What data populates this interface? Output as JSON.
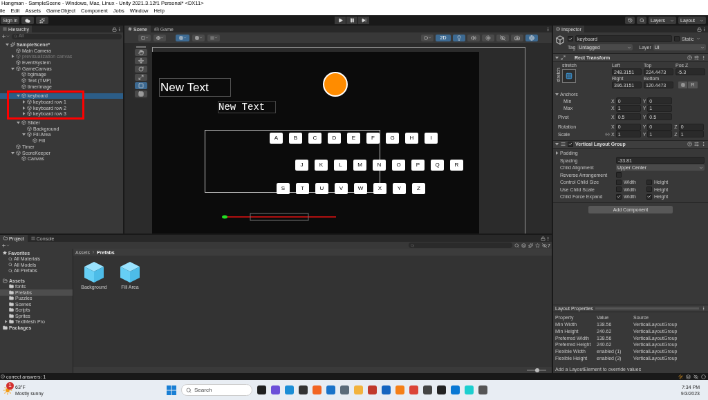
{
  "title_bar": {
    "title": "Hangman - SampleScene - Windows, Mac, Linux - Unity 2021.3.12f1 Personal* <DX11>"
  },
  "menu": [
    "ile",
    "Edit",
    "Assets",
    "GameObject",
    "Component",
    "Jobs",
    "Window",
    "Help"
  ],
  "toolbar": {
    "sign_in": "Sign in",
    "layers": "Layers",
    "layout": "Layout"
  },
  "hierarchy": {
    "tab": "Hierarchy",
    "search_placeholder": "All",
    "tree": [
      {
        "name": "SampleScene*",
        "kind": "scene",
        "expanded": true,
        "selected": false,
        "disabled": false,
        "children": [
          {
            "name": "Main Camera",
            "kind": "object",
            "selected": false,
            "disabled": false
          },
          {
            "name": "previsualization canvas",
            "kind": "object",
            "expanded": false,
            "selected": false,
            "disabled": true
          },
          {
            "name": "EventSystem",
            "kind": "object",
            "selected": false,
            "disabled": false
          },
          {
            "name": "GameCanvas",
            "kind": "object",
            "expanded": true,
            "selected": false,
            "disabled": false,
            "children": [
              {
                "name": "bgimage",
                "kind": "object",
                "selected": false,
                "disabled": false
              },
              {
                "name": "Text (TMP)",
                "kind": "object",
                "selected": false,
                "disabled": false
              },
              {
                "name": "timerImage",
                "kind": "object",
                "selected": false,
                "disabled": false
              },
              {
                "name": "keyboard",
                "kind": "object",
                "expanded": true,
                "selected": true,
                "disabled": false,
                "circled": true,
                "children": [
                  {
                    "name": "keyboard row 1",
                    "kind": "object",
                    "expanded": false,
                    "selected": false,
                    "disabled": false
                  },
                  {
                    "name": "keyboard row 2",
                    "kind": "object",
                    "expanded": false,
                    "selected": false,
                    "disabled": false
                  },
                  {
                    "name": "keyboard row 3",
                    "kind": "object",
                    "expanded": false,
                    "selected": false,
                    "disabled": false
                  }
                ]
              },
              {
                "name": "Slider",
                "kind": "object",
                "expanded": true,
                "selected": false,
                "disabled": false,
                "children": [
                  {
                    "name": "Background",
                    "kind": "object",
                    "selected": false,
                    "disabled": false
                  },
                  {
                    "name": "Fill Area",
                    "kind": "object",
                    "expanded": true,
                    "selected": false,
                    "disabled": false,
                    "children": [
                      {
                        "name": "Fill",
                        "kind": "object",
                        "selected": false,
                        "disabled": false
                      }
                    ]
                  }
                ]
              }
            ]
          },
          {
            "name": "Timer",
            "kind": "object",
            "selected": false,
            "disabled": false
          },
          {
            "name": "ScoreKeeper",
            "kind": "object",
            "expanded": true,
            "selected": false,
            "disabled": false,
            "children": [
              {
                "name": "Canvas",
                "kind": "object",
                "selected": false,
                "disabled": false
              }
            ]
          }
        ]
      }
    ]
  },
  "scene": {
    "tabs": [
      {
        "label": "Scene",
        "kind": "scene",
        "selected": true
      },
      {
        "label": "Game",
        "kind": "game",
        "selected": false
      }
    ],
    "mode_2d": {
      "label": "2D",
      "on": true
    },
    "toggles": [
      {
        "kind": "lighting",
        "on": true
      },
      {
        "kind": "audio",
        "on": false
      },
      {
        "kind": "effects",
        "on": false
      },
      {
        "kind": "visibility",
        "on": false
      },
      {
        "kind": "camera",
        "on": false
      },
      {
        "kind": "gizmos",
        "on": true
      }
    ],
    "tools": [
      {
        "kind": "hand",
        "selected": false
      },
      {
        "kind": "move",
        "selected": false
      },
      {
        "kind": "rotate",
        "selected": false
      },
      {
        "kind": "scale",
        "selected": false
      },
      {
        "kind": "rect",
        "selected": true
      },
      {
        "kind": "transform",
        "selected": false
      }
    ],
    "title_text": "New Text",
    "mono_text": "New Text",
    "keyboard_rows": [
      [
        "A",
        "B",
        "C",
        "D",
        "E",
        "F",
        "G",
        "H",
        "I"
      ],
      [
        "J",
        "K",
        "L",
        "M",
        "N",
        "O",
        "P",
        "Q",
        "R"
      ],
      [
        "S",
        "T",
        "U",
        "V",
        "W",
        "X",
        "Y",
        "Z"
      ]
    ]
  },
  "inspector": {
    "tab": "Inspector",
    "object": {
      "active": true,
      "name": "keyboard",
      "static_label": "Static",
      "static": false,
      "tag_label": "Tag",
      "tag": "Untagged",
      "layer_label": "Layer",
      "layer": "UI"
    },
    "rect_transform": {
      "title": "Rect Transform",
      "expanded": true,
      "preset_top": "stretch",
      "preset_side": "stretch",
      "fields": [
        {
          "label": "Left",
          "value": "248.3151"
        },
        {
          "label": "Top",
          "value": "224.4473"
        },
        {
          "label": "Pos Z",
          "value": "-5.3"
        },
        {
          "label": "Right",
          "value": "396.3151"
        },
        {
          "label": "Bottom",
          "value": "120.4473"
        }
      ],
      "r_button": "R",
      "anchors": {
        "label": "Anchors",
        "expanded": true,
        "children": [
          {
            "label": "Min",
            "axes": [
              {
                "axis": "X",
                "value": "0"
              },
              {
                "axis": "Y",
                "value": "0"
              }
            ]
          },
          {
            "label": "Max",
            "axes": [
              {
                "axis": "X",
                "value": "1"
              },
              {
                "axis": "Y",
                "value": "1"
              }
            ]
          }
        ]
      },
      "rows": [
        {
          "label": "Pivot",
          "linked": false,
          "axes": [
            {
              "axis": "X",
              "value": "0.5"
            },
            {
              "axis": "Y",
              "value": "0.5"
            }
          ]
        },
        {
          "label": "Rotation",
          "linked": false,
          "axes": [
            {
              "axis": "X",
              "value": "0"
            },
            {
              "axis": "Y",
              "value": "0"
            },
            {
              "axis": "Z",
              "value": "0"
            }
          ]
        },
        {
          "label": "Scale",
          "linked": true,
          "axes": [
            {
              "axis": "X",
              "value": "1"
            },
            {
              "axis": "Y",
              "value": "1"
            },
            {
              "axis": "Z",
              "value": "1"
            }
          ]
        }
      ]
    },
    "layout_group": {
      "title": "Vertical Layout Group",
      "expanded": true,
      "enabled": true,
      "padding": {
        "label": "Padding",
        "expanded": false
      },
      "spacing": {
        "label": "Spacing",
        "value": "-33.81"
      },
      "child_alignment": {
        "label": "Child Alignment",
        "value": "Upper Center"
      },
      "reverse": {
        "label": "Reverse Arrangement",
        "checked": false
      },
      "pairs": [
        {
          "label": "Control Child Size",
          "options": [
            {
              "label": "Width",
              "checked": false
            },
            {
              "label": "Height",
              "checked": false
            }
          ]
        },
        {
          "label": "Use Child Scale",
          "options": [
            {
              "label": "Width",
              "checked": false
            },
            {
              "label": "Height",
              "checked": false
            }
          ]
        },
        {
          "label": "Child Force Expand",
          "options": [
            {
              "label": "Width",
              "checked": true
            },
            {
              "label": "Height",
              "checked": true
            }
          ]
        }
      ]
    },
    "add_component": "Add Component",
    "layout_properties": {
      "title": "Layout Properties",
      "columns": [
        "Property",
        "Value",
        "Source"
      ],
      "rows": [
        [
          "Min Width",
          "138.56",
          "VerticalLayoutGroup"
        ],
        [
          "Min Height",
          "240.62",
          "VerticalLayoutGroup"
        ],
        [
          "Preferred Width",
          "138.56",
          "VerticalLayoutGroup"
        ],
        [
          "Preferred Height",
          "240.62",
          "VerticalLayoutGroup"
        ],
        [
          "Flexible Width",
          "enabled (1)",
          "VerticalLayoutGroup"
        ],
        [
          "Flexible Height",
          "enabled (3)",
          "VerticalLayoutGroup"
        ]
      ],
      "note": "Add a LayoutElement to override values"
    }
  },
  "project": {
    "tabs": [
      {
        "label": "Project",
        "kind": "project",
        "selected": true
      },
      {
        "label": "Console",
        "kind": "console",
        "selected": false
      }
    ],
    "hidden_count": "7",
    "favorites": {
      "label": "Favorites",
      "items": [
        "All Materials",
        "All Models",
        "All Prefabs"
      ]
    },
    "assets": {
      "label": "Assets",
      "children": [
        {
          "name": "fonts",
          "selected": false
        },
        {
          "name": "Prefabs",
          "selected": true
        },
        {
          "name": "Puzzles",
          "selected": false
        },
        {
          "name": "Scenes",
          "selected": false
        },
        {
          "name": "Scripts",
          "selected": false
        },
        {
          "name": "Sprites",
          "selected": false
        },
        {
          "name": "TextMesh Pro",
          "selected": false,
          "expanded": false
        }
      ]
    },
    "packages": "Packages",
    "breadcrumb": [
      "Assets",
      "Prefabs"
    ],
    "files": [
      "Background",
      "Fill Area"
    ],
    "icon_size": {
      "level": 0.55
    }
  },
  "status_bar": {
    "message": "correct answers: 1"
  },
  "taskbar": {
    "weather": {
      "badge": "1",
      "temperature": "63°F",
      "condition": "Mostly sunny"
    },
    "search_placeholder": "Search",
    "time": "7:34 PM",
    "date": "9/3/2023"
  }
}
